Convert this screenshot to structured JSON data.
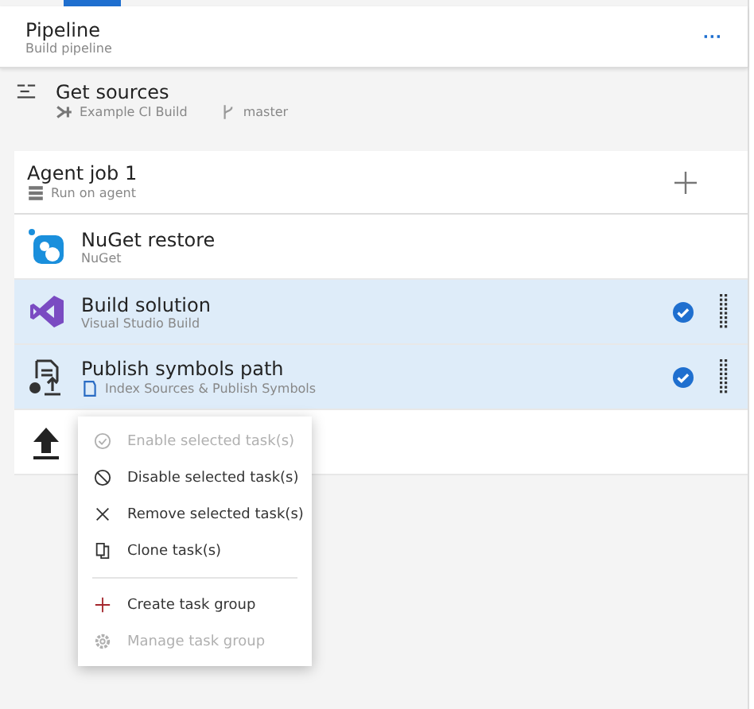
{
  "pipeline": {
    "title": "Pipeline",
    "subtitle": "Build pipeline",
    "menu_icon": "···"
  },
  "sources": {
    "title": "Get sources",
    "repository": "Example CI Build",
    "branch": "master"
  },
  "job": {
    "title": "Agent job 1",
    "subtitle": "Run on agent"
  },
  "tasks": [
    {
      "kind": "nuget",
      "title": "NuGet restore",
      "subtitle": "NuGet",
      "selected": false
    },
    {
      "kind": "vs",
      "title": "Build solution",
      "subtitle": "Visual Studio Build",
      "selected": true
    },
    {
      "kind": "publish",
      "title": "Publish symbols path",
      "subtitle": "Index Sources & Publish Symbols",
      "selected": true
    },
    {
      "kind": "upload",
      "selected": false
    }
  ],
  "context_menu": [
    [
      {
        "kind": "check",
        "label": "Enable selected task(s)",
        "disabled": true
      },
      {
        "kind": "block",
        "label": "Disable selected task(s)",
        "disabled": false
      },
      {
        "kind": "close",
        "label": "Remove selected task(s)",
        "disabled": false
      },
      {
        "kind": "clone",
        "label": "Clone task(s)",
        "disabled": false
      }
    ],
    [
      {
        "kind": "plus",
        "label": "Create task group",
        "disabled": false
      },
      {
        "kind": "gear",
        "label": "Manage task group",
        "disabled": true
      }
    ]
  ]
}
